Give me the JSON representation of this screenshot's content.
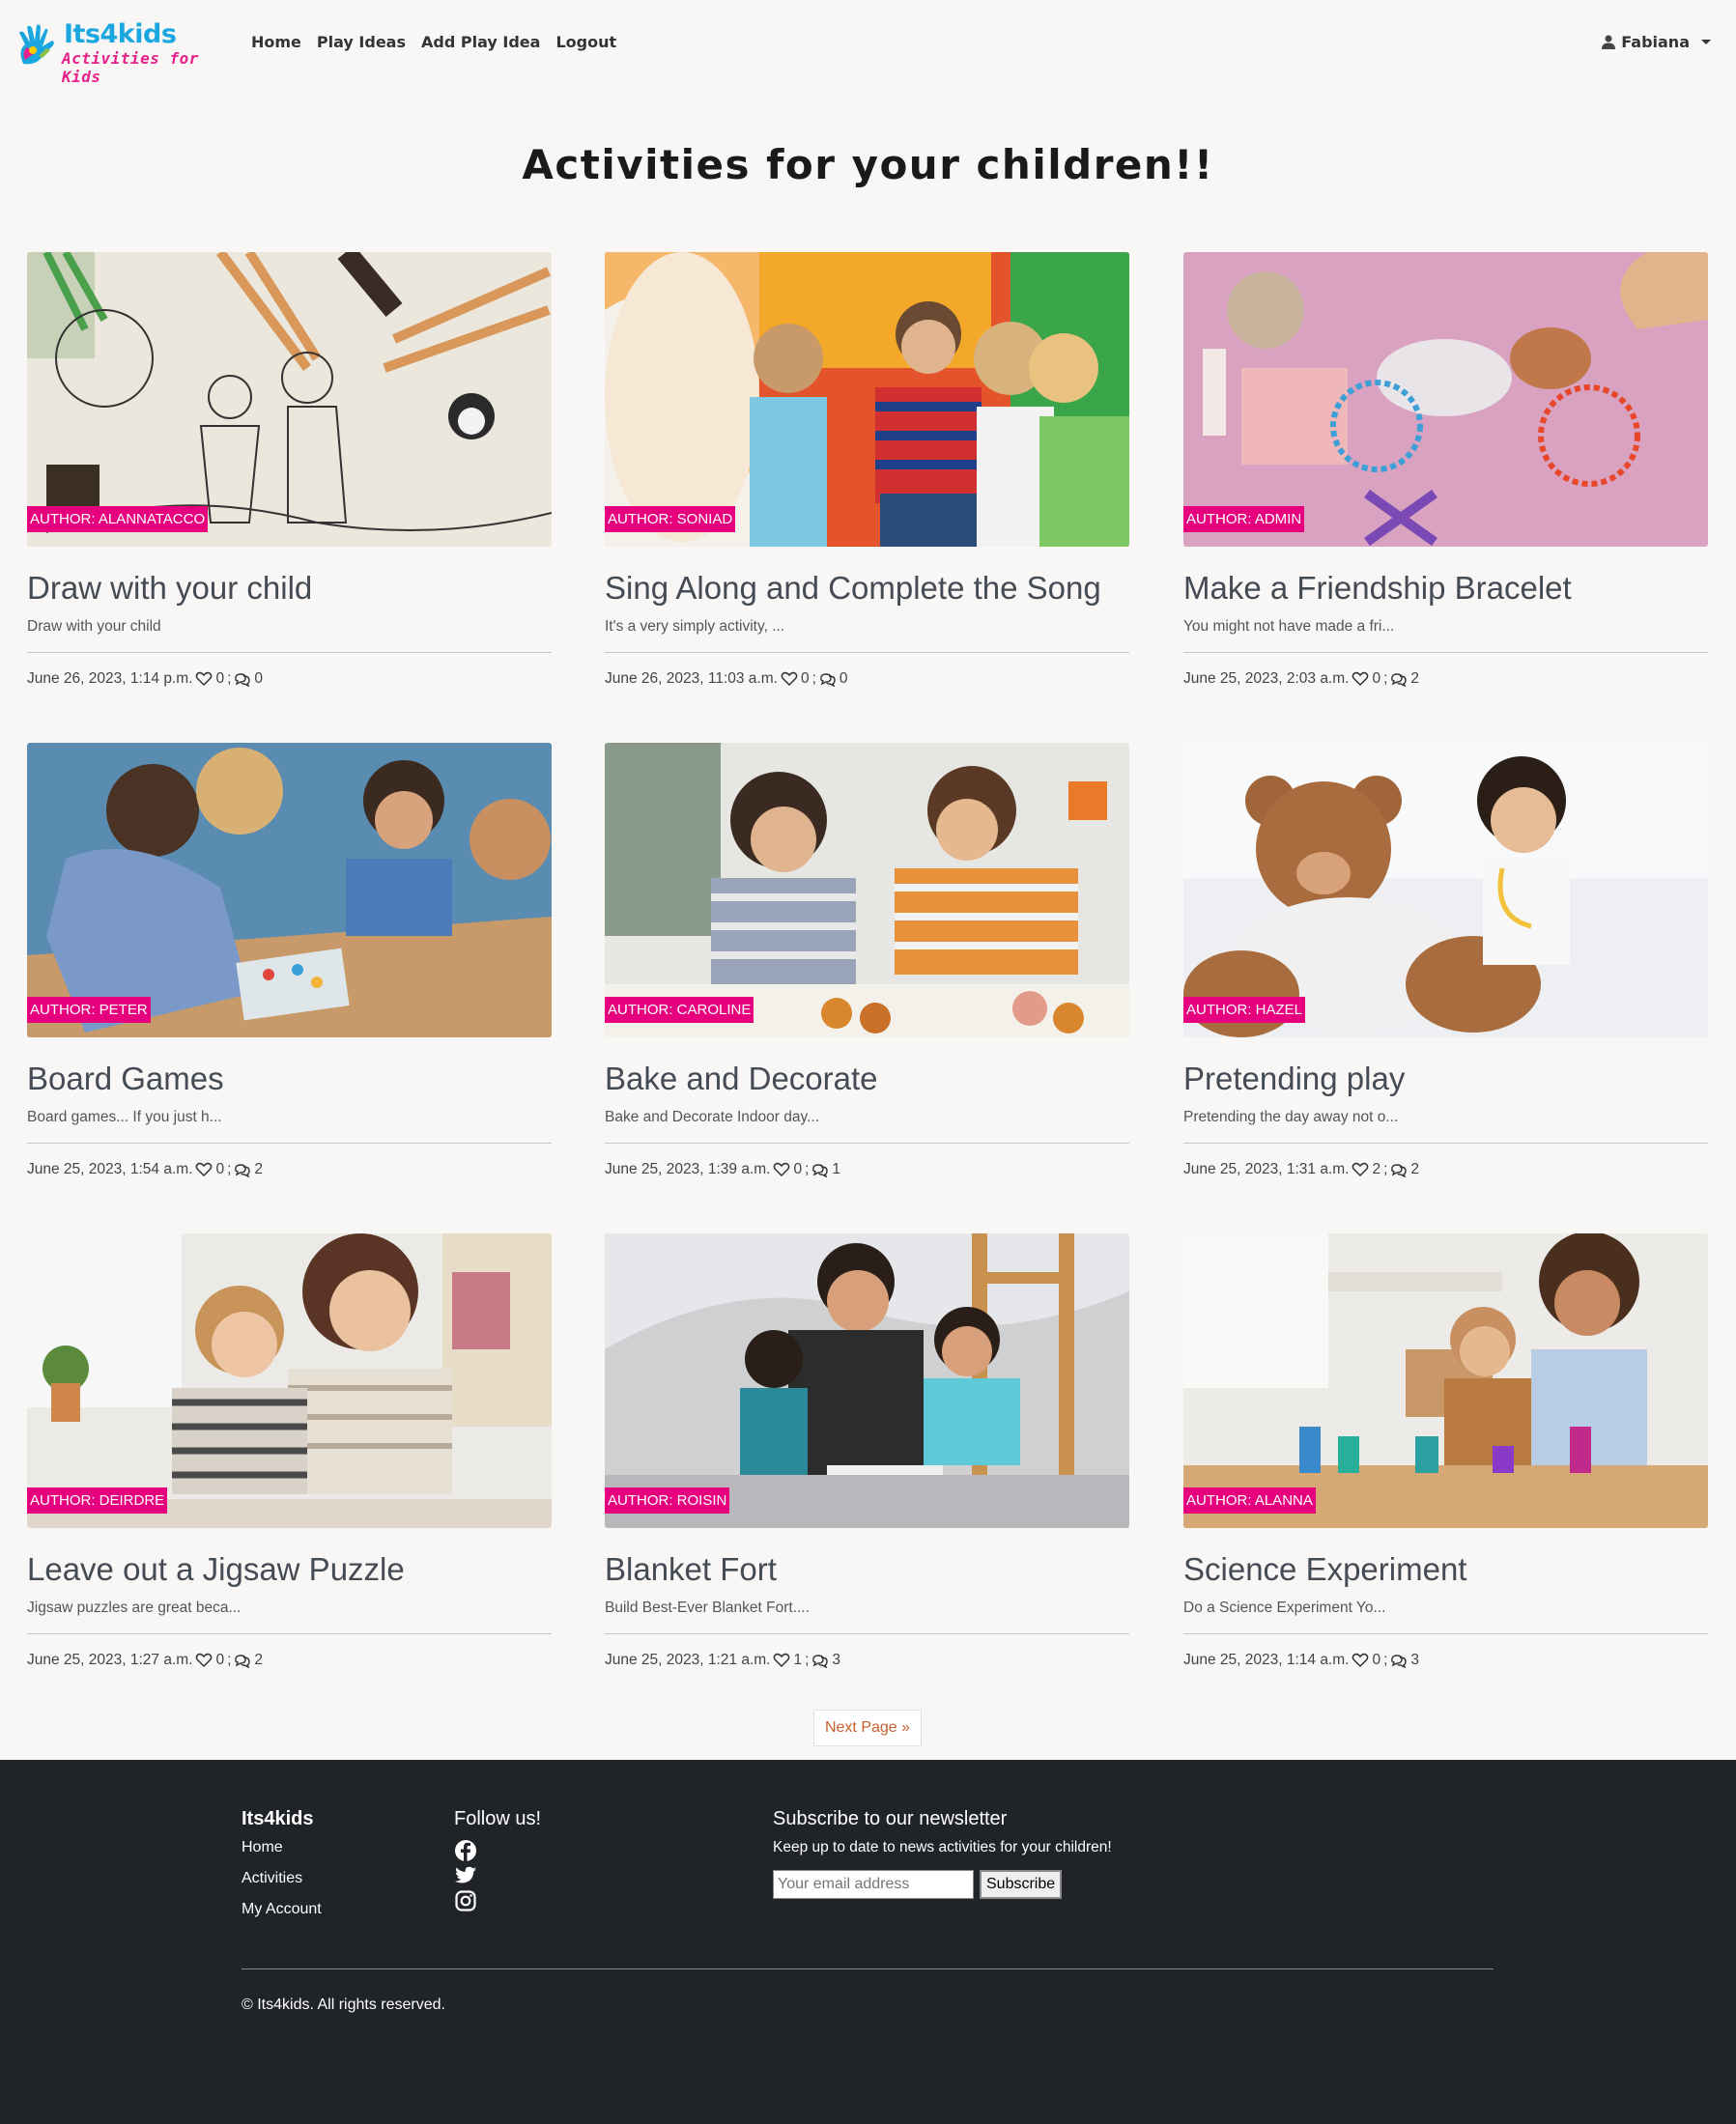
{
  "brand": {
    "title": "Its4kids",
    "subtitle": "Activities for Kids",
    "colors": {
      "title": "#1aa7e0",
      "subtitle": "#e6218a"
    }
  },
  "nav": {
    "links": [
      "Home",
      "Play Ideas",
      "Add Play Idea",
      "Logout"
    ],
    "user": "Fabiana",
    "user_icon": "user-icon"
  },
  "heading": "Activities for your children!!",
  "accent_color": "#e6007e",
  "cards": [
    {
      "author": "AUTHOR: ALANNATACCO",
      "title": "Draw with your child",
      "excerpt": "Draw with your child",
      "date": "June 26, 2023, 1:14 p.m.",
      "likes": "0",
      "comments": "0"
    },
    {
      "author": "AUTHOR: SONIAD",
      "title": "Sing Along and Complete the Song",
      "excerpt": "It's a very simply activity, ...",
      "date": "June 26, 2023, 11:03 a.m.",
      "likes": "0",
      "comments": "0"
    },
    {
      "author": "AUTHOR: ADMIN",
      "title": "Make a Friendship Bracelet",
      "excerpt": "You might not have made a fri...",
      "date": "June 25, 2023, 2:03 a.m.",
      "likes": "0",
      "comments": "2"
    },
    {
      "author": "AUTHOR: PETER",
      "title": "Board Games",
      "excerpt": "Board games... If you just h...",
      "date": "June 25, 2023, 1:54 a.m.",
      "likes": "0",
      "comments": "2"
    },
    {
      "author": "AUTHOR: CAROLINE",
      "title": "Bake and Decorate",
      "excerpt": "Bake and Decorate Indoor day...",
      "date": "June 25, 2023, 1:39 a.m.",
      "likes": "0",
      "comments": "1"
    },
    {
      "author": "AUTHOR: HAZEL",
      "title": "Pretending play",
      "excerpt": "Pretending the day away not o...",
      "date": "June 25, 2023, 1:31 a.m.",
      "likes": "2",
      "comments": "2"
    },
    {
      "author": "AUTHOR: DEIRDRE",
      "title": "Leave out a Jigsaw Puzzle",
      "excerpt": "Jigsaw puzzles are great beca...",
      "date": "June 25, 2023, 1:27 a.m.",
      "likes": "0",
      "comments": "2"
    },
    {
      "author": "AUTHOR: ROISIN",
      "title": "Blanket Fort",
      "excerpt": "Build Best-Ever Blanket Fort....",
      "date": "June 25, 2023, 1:21 a.m.",
      "likes": "1",
      "comments": "3"
    },
    {
      "author": "AUTHOR: ALANNA",
      "title": "Science Experiment",
      "excerpt": "Do a Science Experiment Yo...",
      "date": "June 25, 2023, 1:14 a.m.",
      "likes": "0",
      "comments": "3"
    }
  ],
  "pagination": {
    "next": "Next Page »"
  },
  "footer": {
    "brand": "Its4kids",
    "links": [
      "Home",
      "Activities",
      "My Account"
    ],
    "follow_heading": "Follow us!",
    "social_icons": [
      "facebook-icon",
      "twitter-icon",
      "instagram-icon"
    ],
    "newsletter_heading": "Subscribe to our newsletter",
    "newsletter_text": "Keep up to date to news activities for your children!",
    "email_placeholder": "Your email address",
    "subscribe_label": "Subscribe",
    "copyright": "© Its4kids. All rights reserved."
  }
}
